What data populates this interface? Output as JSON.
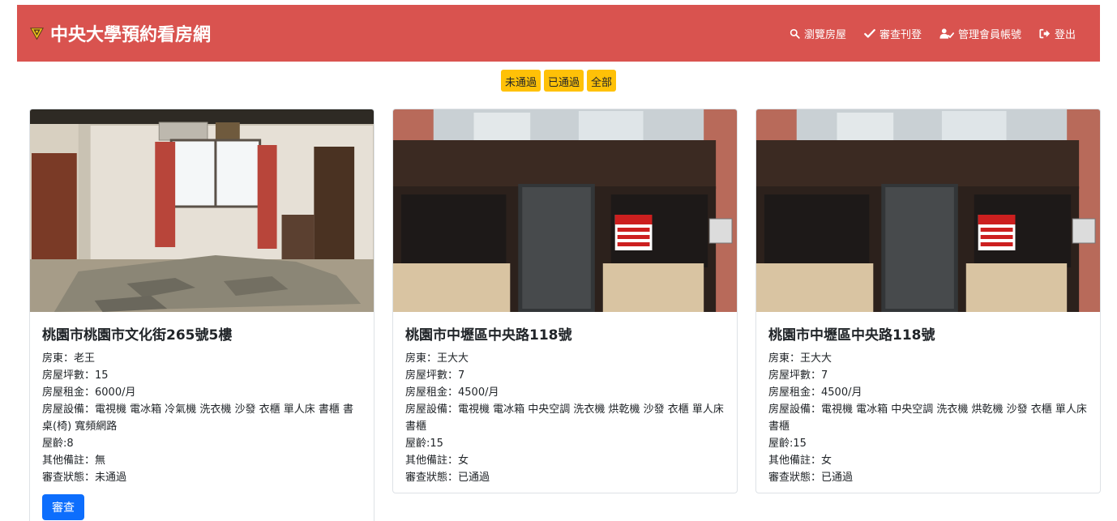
{
  "header": {
    "brand": "中央大學預約看房網",
    "nav": [
      {
        "label": "瀏覽房屋",
        "icon": "search-icon"
      },
      {
        "label": "審查刊登",
        "icon": "check-icon"
      },
      {
        "label": "管理會員帳號",
        "icon": "user-check-icon"
      },
      {
        "label": "登出",
        "icon": "sign-out-icon"
      }
    ],
    "colors": {
      "navbar": "#d9534f",
      "filter": "#ffc107",
      "primary": "#0d6efd"
    }
  },
  "filters": [
    "未通過",
    "已通過",
    "全部"
  ],
  "listings": [
    {
      "title": "桃園市桃園市文化街265號5樓",
      "landlord": "房東：老王",
      "size": "房屋坪數：15",
      "rent": "房屋租金：6000/月",
      "equipment": "房屋設備：電視機 電冰箱 冷氣機 洗衣機 沙發 衣櫃 單人床 書櫃 書桌(椅) 寬頻網路",
      "age": "屋齡:8",
      "notes": "其他備註：無",
      "status": "審查狀態：未通過",
      "button": "審查",
      "image": "room-interior"
    },
    {
      "title": "桃園市中壢區中央路118號",
      "landlord": "房東：王大大",
      "size": "房屋坪數：7",
      "rent": "房屋租金：4500/月",
      "equipment": "房屋設備：電視機 電冰箱 中央空調 洗衣機 烘乾機 沙發 衣櫃 單人床 書櫃",
      "age": "屋齡:15",
      "notes": "其他備註：女",
      "status": "審查狀態：已通過",
      "image": "building-facade",
      "sign_text": [
        "雅房套房出租",
        "大小戶數甚有",
        "戶戶皆分套"
      ]
    },
    {
      "title": "桃園市中壢區中央路118號",
      "landlord": "房東：王大大",
      "size": "房屋坪數：7",
      "rent": "房屋租金：4500/月",
      "equipment": "房屋設備：電視機 電冰箱 中央空調 洗衣機 烘乾機 沙發 衣櫃 單人床 書櫃",
      "age": "屋齡:15",
      "notes": "其他備註：女",
      "status": "審查狀態：已通過",
      "image": "building-facade",
      "sign_text": [
        "雅房套房出租",
        "大小戶數甚有",
        "戶戶皆分套"
      ]
    }
  ]
}
